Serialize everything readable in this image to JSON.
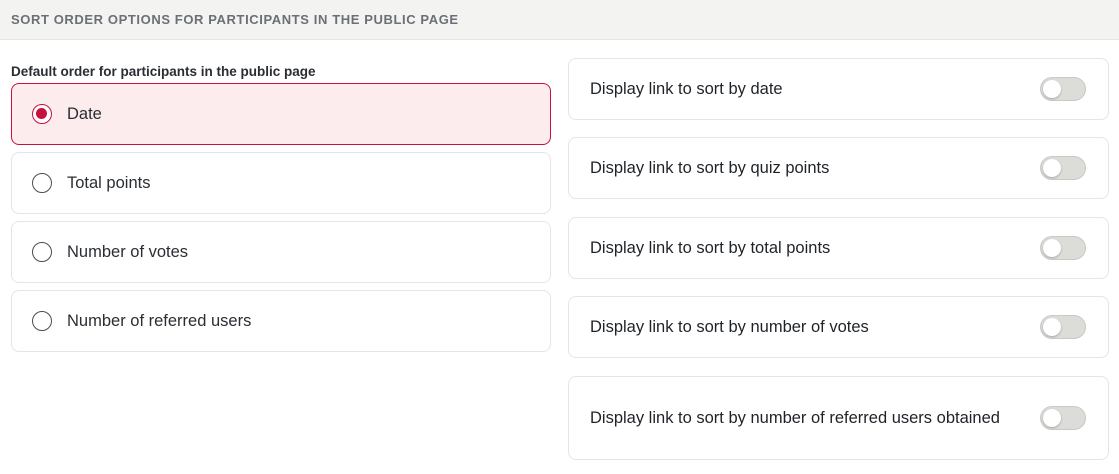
{
  "section": {
    "title": "SORT ORDER OPTIONS FOR PARTICIPANTS IN THE PUBLIC PAGE"
  },
  "default_order": {
    "label": "Default order for participants in the public page",
    "selected": "Date",
    "options": [
      {
        "label": "Date",
        "selected": true
      },
      {
        "label": "Total points",
        "selected": false
      },
      {
        "label": "Number of votes",
        "selected": false
      },
      {
        "label": "Number of referred users",
        "selected": false
      }
    ]
  },
  "display_links": [
    {
      "label": "Display link to sort by date",
      "enabled": false
    },
    {
      "label": "Display link to sort by quiz points",
      "enabled": false
    },
    {
      "label": "Display link to sort by total points",
      "enabled": false
    },
    {
      "label": "Display link to sort by number of votes",
      "enabled": false
    },
    {
      "label": "Display link to sort by number of referred users obtained",
      "enabled": false
    }
  ],
  "colors": {
    "accent": "#c8103e",
    "selected_bg": "#fdecee",
    "toggle_off": "#dcdcd8"
  }
}
